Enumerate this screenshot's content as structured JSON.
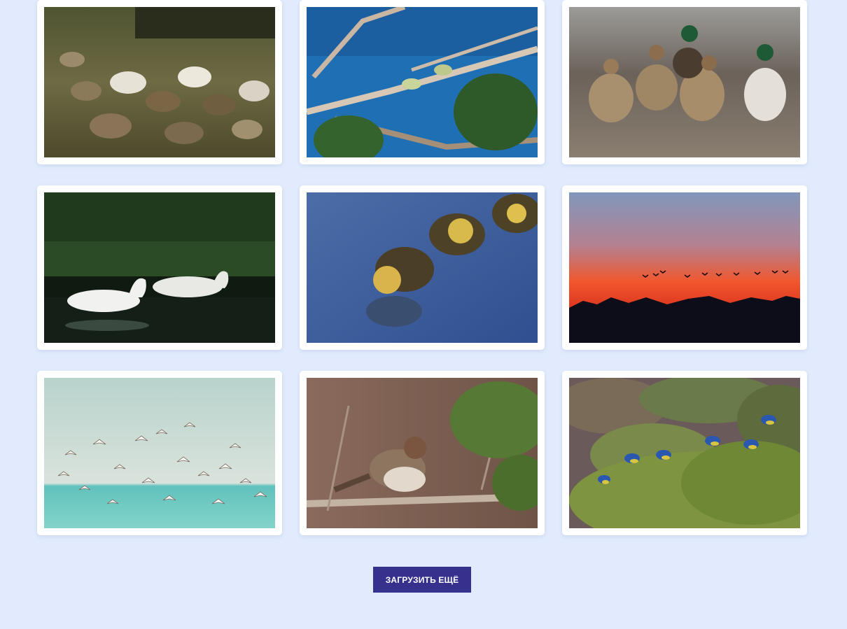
{
  "gallery": {
    "items": [
      {
        "subject": "geese-flock"
      },
      {
        "subject": "tits-on-branch"
      },
      {
        "subject": "mallard-ducks"
      },
      {
        "subject": "swans"
      },
      {
        "subject": "ducklings"
      },
      {
        "subject": "birds-sunset"
      },
      {
        "subject": "seagulls"
      },
      {
        "subject": "sparrow-on-branch"
      },
      {
        "subject": "blue-tits-flying"
      }
    ]
  },
  "load_more": {
    "label": "ЗАГРУЗИТЬ ЕЩЁ",
    "color": "#36318d"
  },
  "page": {
    "background": "#e1ebfd"
  }
}
